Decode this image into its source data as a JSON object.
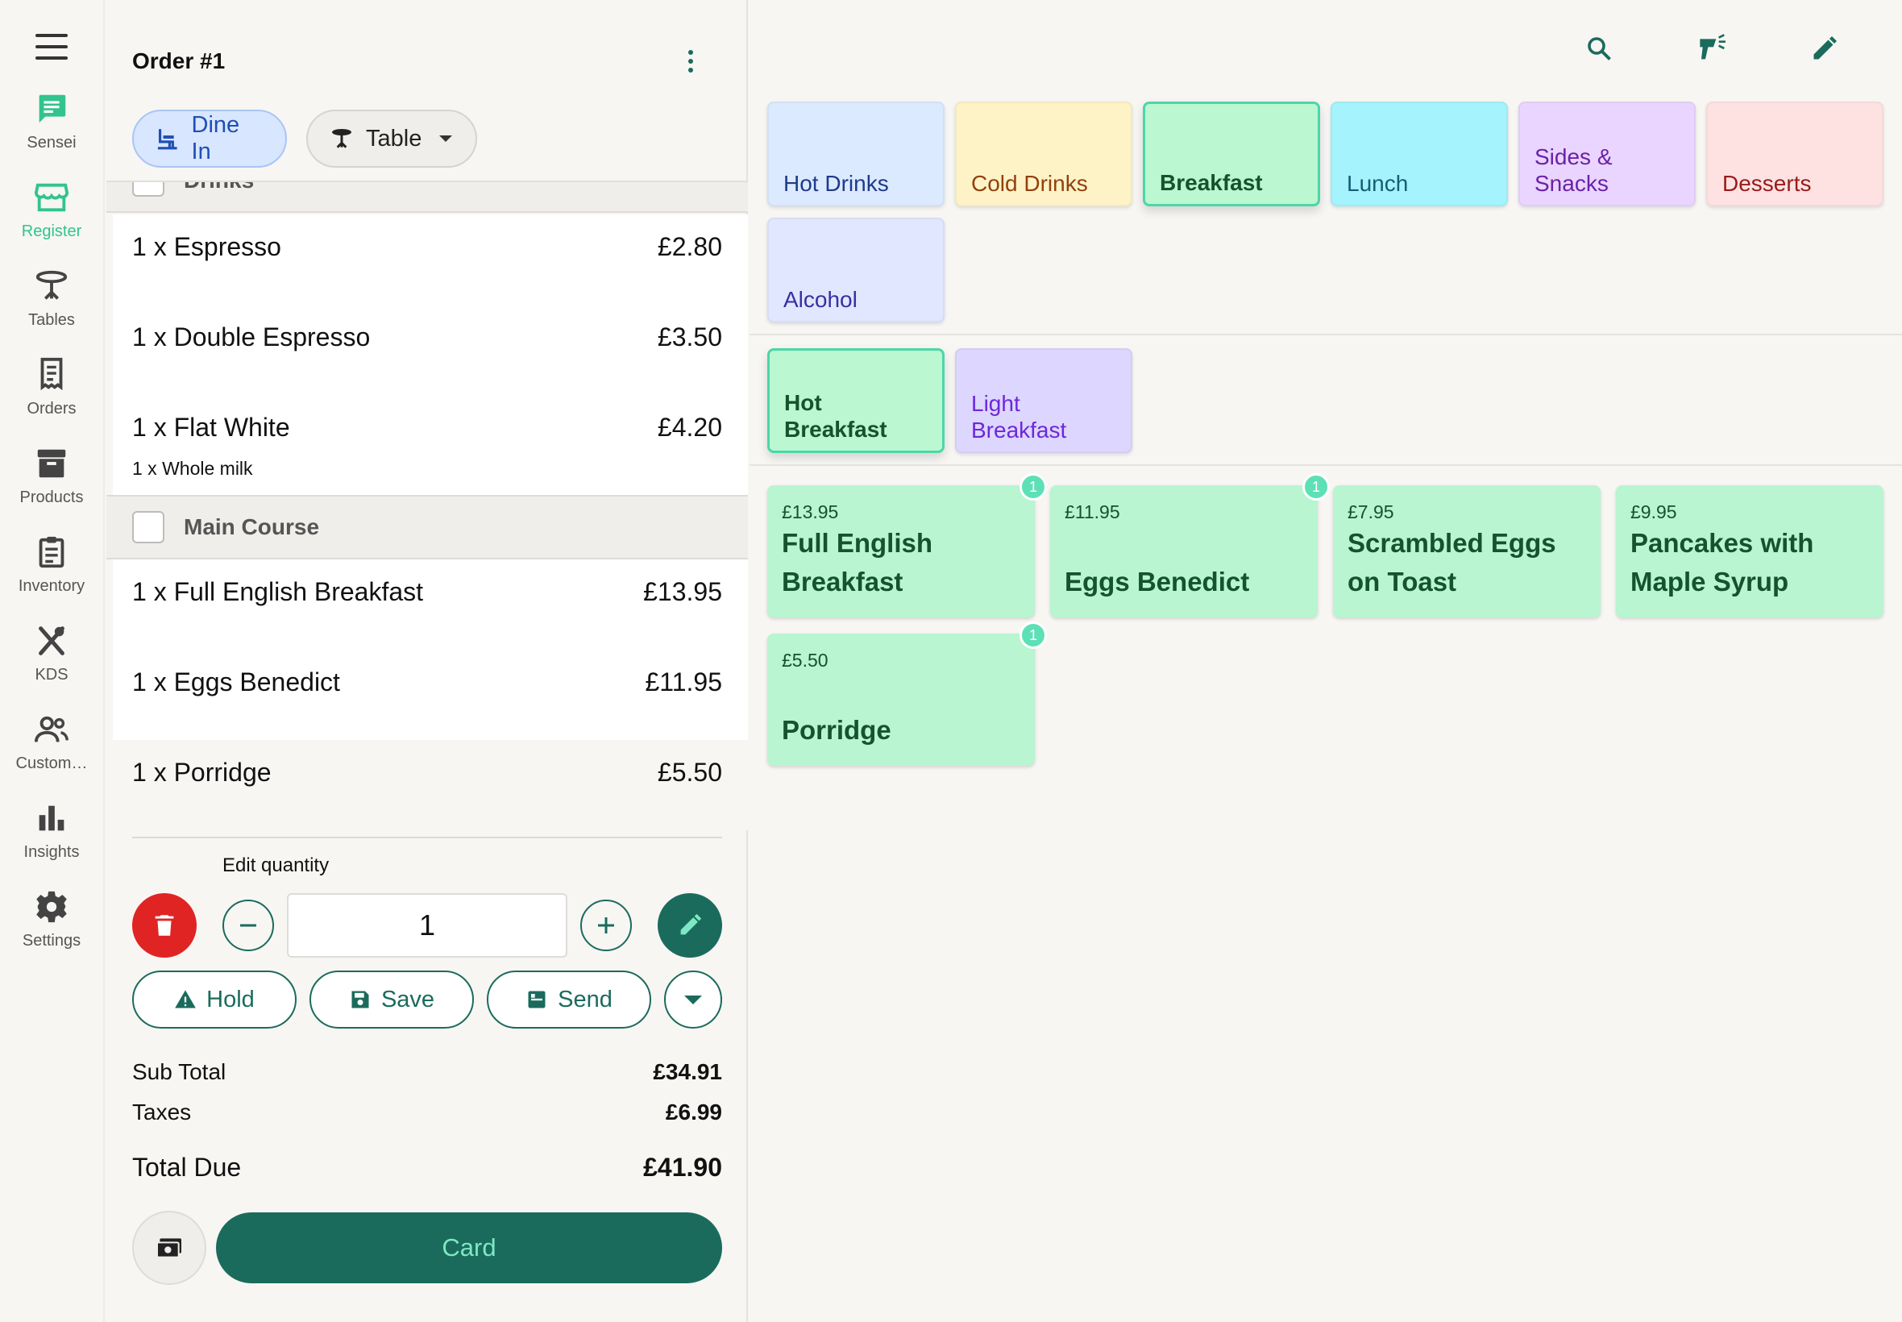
{
  "sidebar": {
    "items": [
      {
        "label": "Sensei",
        "icon": "chat-icon"
      },
      {
        "label": "Register",
        "icon": "storefront-icon"
      },
      {
        "label": "Tables",
        "icon": "table-icon"
      },
      {
        "label": "Orders",
        "icon": "receipt-icon"
      },
      {
        "label": "Products",
        "icon": "archive-icon"
      },
      {
        "label": "Inventory",
        "icon": "clipboard-icon"
      },
      {
        "label": "KDS",
        "icon": "utensils-icon"
      },
      {
        "label": "Custom…",
        "icon": "people-icon"
      },
      {
        "label": "Insights",
        "icon": "bar-chart-icon"
      },
      {
        "label": "Settings",
        "icon": "gear-icon"
      }
    ]
  },
  "order": {
    "title": "Order #1",
    "dine_in_label": "Dine In",
    "table_label": "Table",
    "sections": [
      {
        "label": "Drinks"
      },
      {
        "label": "Main Course"
      }
    ],
    "items": [
      {
        "name": "1 x Espresso",
        "price": "£2.80"
      },
      {
        "name": "1 x Double Espresso",
        "price": "£3.50"
      },
      {
        "name": "1 x Flat White",
        "price": "£4.20",
        "modifier": "1 x Whole milk"
      },
      {
        "name": "1 x Full English Breakfast",
        "price": "£13.95"
      },
      {
        "name": "1 x Eggs Benedict",
        "price": "£11.95"
      },
      {
        "name": "1 x Porridge",
        "price": "£5.50"
      }
    ],
    "edit_quantity_label": "Edit quantity",
    "quantity": "1",
    "actions": {
      "hold": "Hold",
      "save": "Save",
      "send": "Send"
    },
    "subtotal_label": "Sub Total",
    "subtotal": "£34.91",
    "taxes_label": "Taxes",
    "taxes": "£6.99",
    "total_label": "Total Due",
    "total": "£41.90",
    "card_label": "Card"
  },
  "categories": [
    {
      "label": "Hot Drinks",
      "bg": "#dbeafe",
      "fg": "#1e3a8a"
    },
    {
      "label": "Cold Drinks",
      "bg": "#fef3c7",
      "fg": "#92400e"
    },
    {
      "label": "Breakfast",
      "bg": "#bbf7d0",
      "fg": "#14532d",
      "selected": true
    },
    {
      "label": "Lunch",
      "bg": "#a5f3fc",
      "fg": "#155e75"
    },
    {
      "label": "Sides &\nSnacks",
      "bg": "#e9d5ff",
      "fg": "#6b21a8"
    },
    {
      "label": "Desserts",
      "bg": "#fee2e2",
      "fg": "#991b1b"
    },
    {
      "label": "Alcohol",
      "bg": "#e0e7ff",
      "fg": "#3730a3"
    }
  ],
  "subcategories": [
    {
      "label": "Hot\nBreakfast",
      "bg": "#bbf7d0",
      "fg": "#14532d",
      "selected": true
    },
    {
      "label": "Light\nBreakfast",
      "bg": "#ddd6fe",
      "fg": "#6d28d9"
    }
  ],
  "products": [
    {
      "price": "£13.95",
      "name": "Full English\nBreakfast",
      "badge": "1"
    },
    {
      "price": "£11.95",
      "name": "Eggs Benedict",
      "badge": "1"
    },
    {
      "price": "£7.95",
      "name": "Scrambled Eggs\non Toast"
    },
    {
      "price": "£9.95",
      "name": "Pancakes with\nMaple Syrup"
    },
    {
      "price": "£5.50",
      "name": "Porridge",
      "badge": "1"
    }
  ],
  "colors": {
    "accent": "#1b6b5d",
    "accent_light": "#31c48d",
    "danger": "#e02424"
  }
}
